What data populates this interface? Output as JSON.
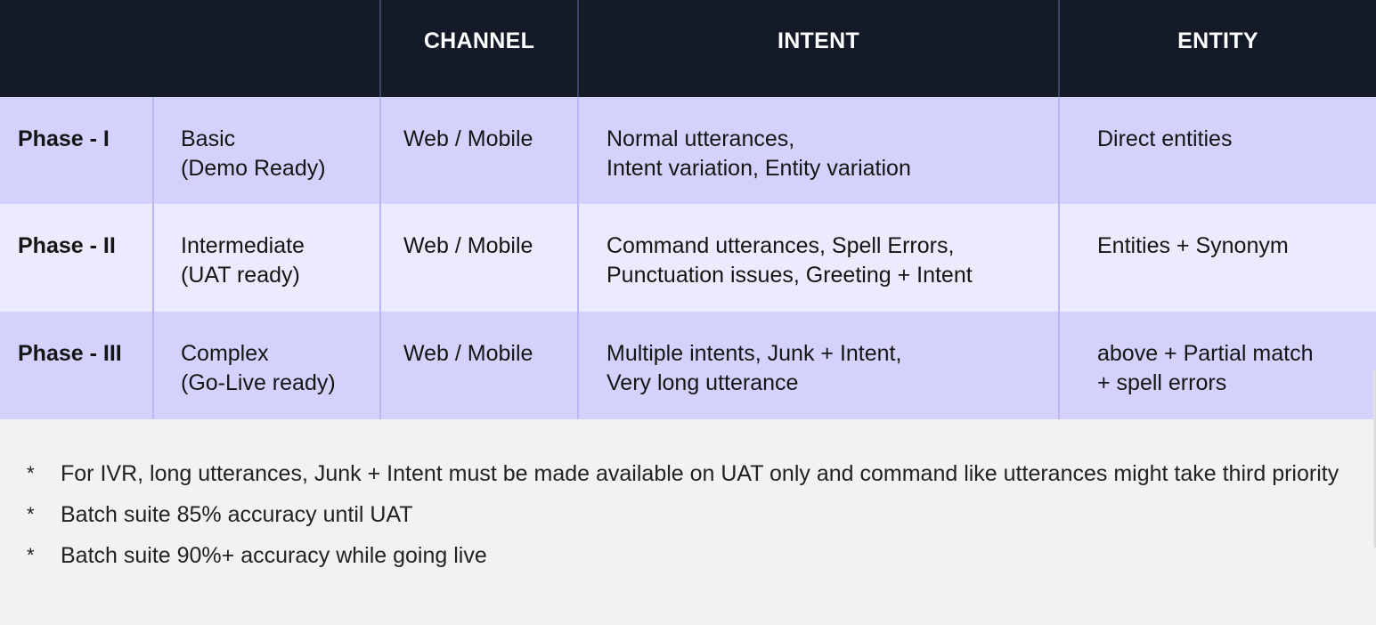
{
  "table": {
    "headers": [
      "",
      "CHANNEL",
      "INTENT",
      "ENTITY"
    ],
    "rows": [
      {
        "phase": "Phase - I",
        "level": "Basic\n(Demo Ready)",
        "channel": "Web / Mobile",
        "intent": "Normal utterances,\nIntent variation, Entity variation",
        "entity": "Direct entities"
      },
      {
        "phase": "Phase - II",
        "level": "Intermediate\n(UAT ready)",
        "channel": "Web / Mobile",
        "intent": "Command utterances, Spell Errors,\nPunctuation issues, Greeting + Intent",
        "entity": "Entities + Synonym"
      },
      {
        "phase": "Phase - III",
        "level": "Complex\n(Go-Live ready)",
        "channel": "Web / Mobile",
        "intent": "Multiple intents, Junk + Intent,\nVery long utterance",
        "entity": "above + Partial match\n+ spell errors"
      }
    ]
  },
  "notes": {
    "bullet": "*",
    "items": [
      "For IVR, long utterances, Junk + Intent must be made available on UAT only and command like utterances might take third priority",
      "Batch suite 85% accuracy until UAT",
      "Batch suite 90%+ accuracy while going live"
    ]
  },
  "colors": {
    "header_bg": "#141a28",
    "row_odd_bg": "#d2d2fc",
    "row_even_bg": "#ebebfd",
    "page_bg": "#f2f2f2"
  }
}
